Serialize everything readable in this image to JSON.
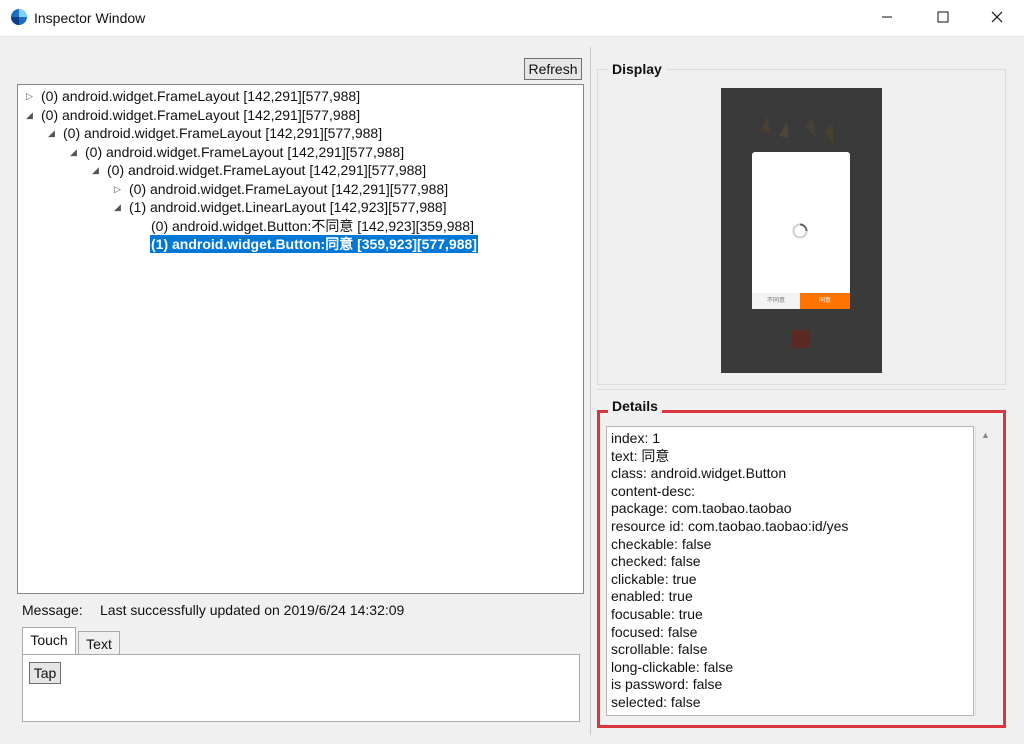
{
  "window": {
    "title": "Inspector Window",
    "controls": {
      "minimize": "—",
      "maximize": "☐",
      "close": "✕"
    }
  },
  "toolbar": {
    "refresh_label": "Refresh"
  },
  "tree": {
    "nodes": [
      {
        "text": "(0) android.widget.FrameLayout [142,291][577,988]",
        "depth": 0,
        "state": "collapsed",
        "selected": false
      },
      {
        "text": "(0) android.widget.FrameLayout [142,291][577,988]",
        "depth": 0,
        "state": "expanded",
        "selected": false
      },
      {
        "text": "(0) android.widget.FrameLayout [142,291][577,988]",
        "depth": 1,
        "state": "expanded",
        "selected": false
      },
      {
        "text": "(0) android.widget.FrameLayout [142,291][577,988]",
        "depth": 2,
        "state": "expanded",
        "selected": false
      },
      {
        "text": "(0) android.widget.FrameLayout [142,291][577,988]",
        "depth": 3,
        "state": "expanded",
        "selected": false
      },
      {
        "text": "(0) android.widget.FrameLayout [142,291][577,988]",
        "depth": 4,
        "state": "collapsed",
        "selected": false
      },
      {
        "text": "(1) android.widget.LinearLayout [142,923][577,988]",
        "depth": 4,
        "state": "expanded",
        "selected": false
      },
      {
        "text": "(0) android.widget.Button:不同意 [142,923][359,988]",
        "depth": 5,
        "state": "leaf",
        "selected": false
      },
      {
        "text": "(1) android.widget.Button:同意 [359,923][577,988]",
        "depth": 5,
        "state": "leaf",
        "selected": true
      }
    ]
  },
  "message": {
    "label": "Message:",
    "value": "Last successfully updated on 2019/6/24 14:32:09"
  },
  "tabs": [
    {
      "label": "Touch",
      "active": true
    },
    {
      "label": "Text",
      "active": false
    }
  ],
  "touch": {
    "tap_label": "Tap"
  },
  "display": {
    "title": "Display",
    "dialog_left_button": "不同意",
    "dialog_right_button": "同意",
    "colors": {
      "phone_bg": "#3a3a3a",
      "accent": "#ff7300"
    }
  },
  "details": {
    "title": "Details",
    "lines": [
      "index: 1",
      "text: 同意",
      "class: android.widget.Button",
      "content-desc:",
      "package: com.taobao.taobao",
      "resource id: com.taobao.taobao:id/yes",
      "checkable: false",
      "checked: false",
      "clickable: true",
      "enabled: true",
      "focusable: true",
      "focused: false",
      "scrollable: false",
      "long-clickable: false",
      "is password: false",
      "selected: false"
    ],
    "highlight_color": "#d9363e"
  },
  "colors": {
    "selection": "#0078d7",
    "window_bg": "#f0f0f0"
  }
}
